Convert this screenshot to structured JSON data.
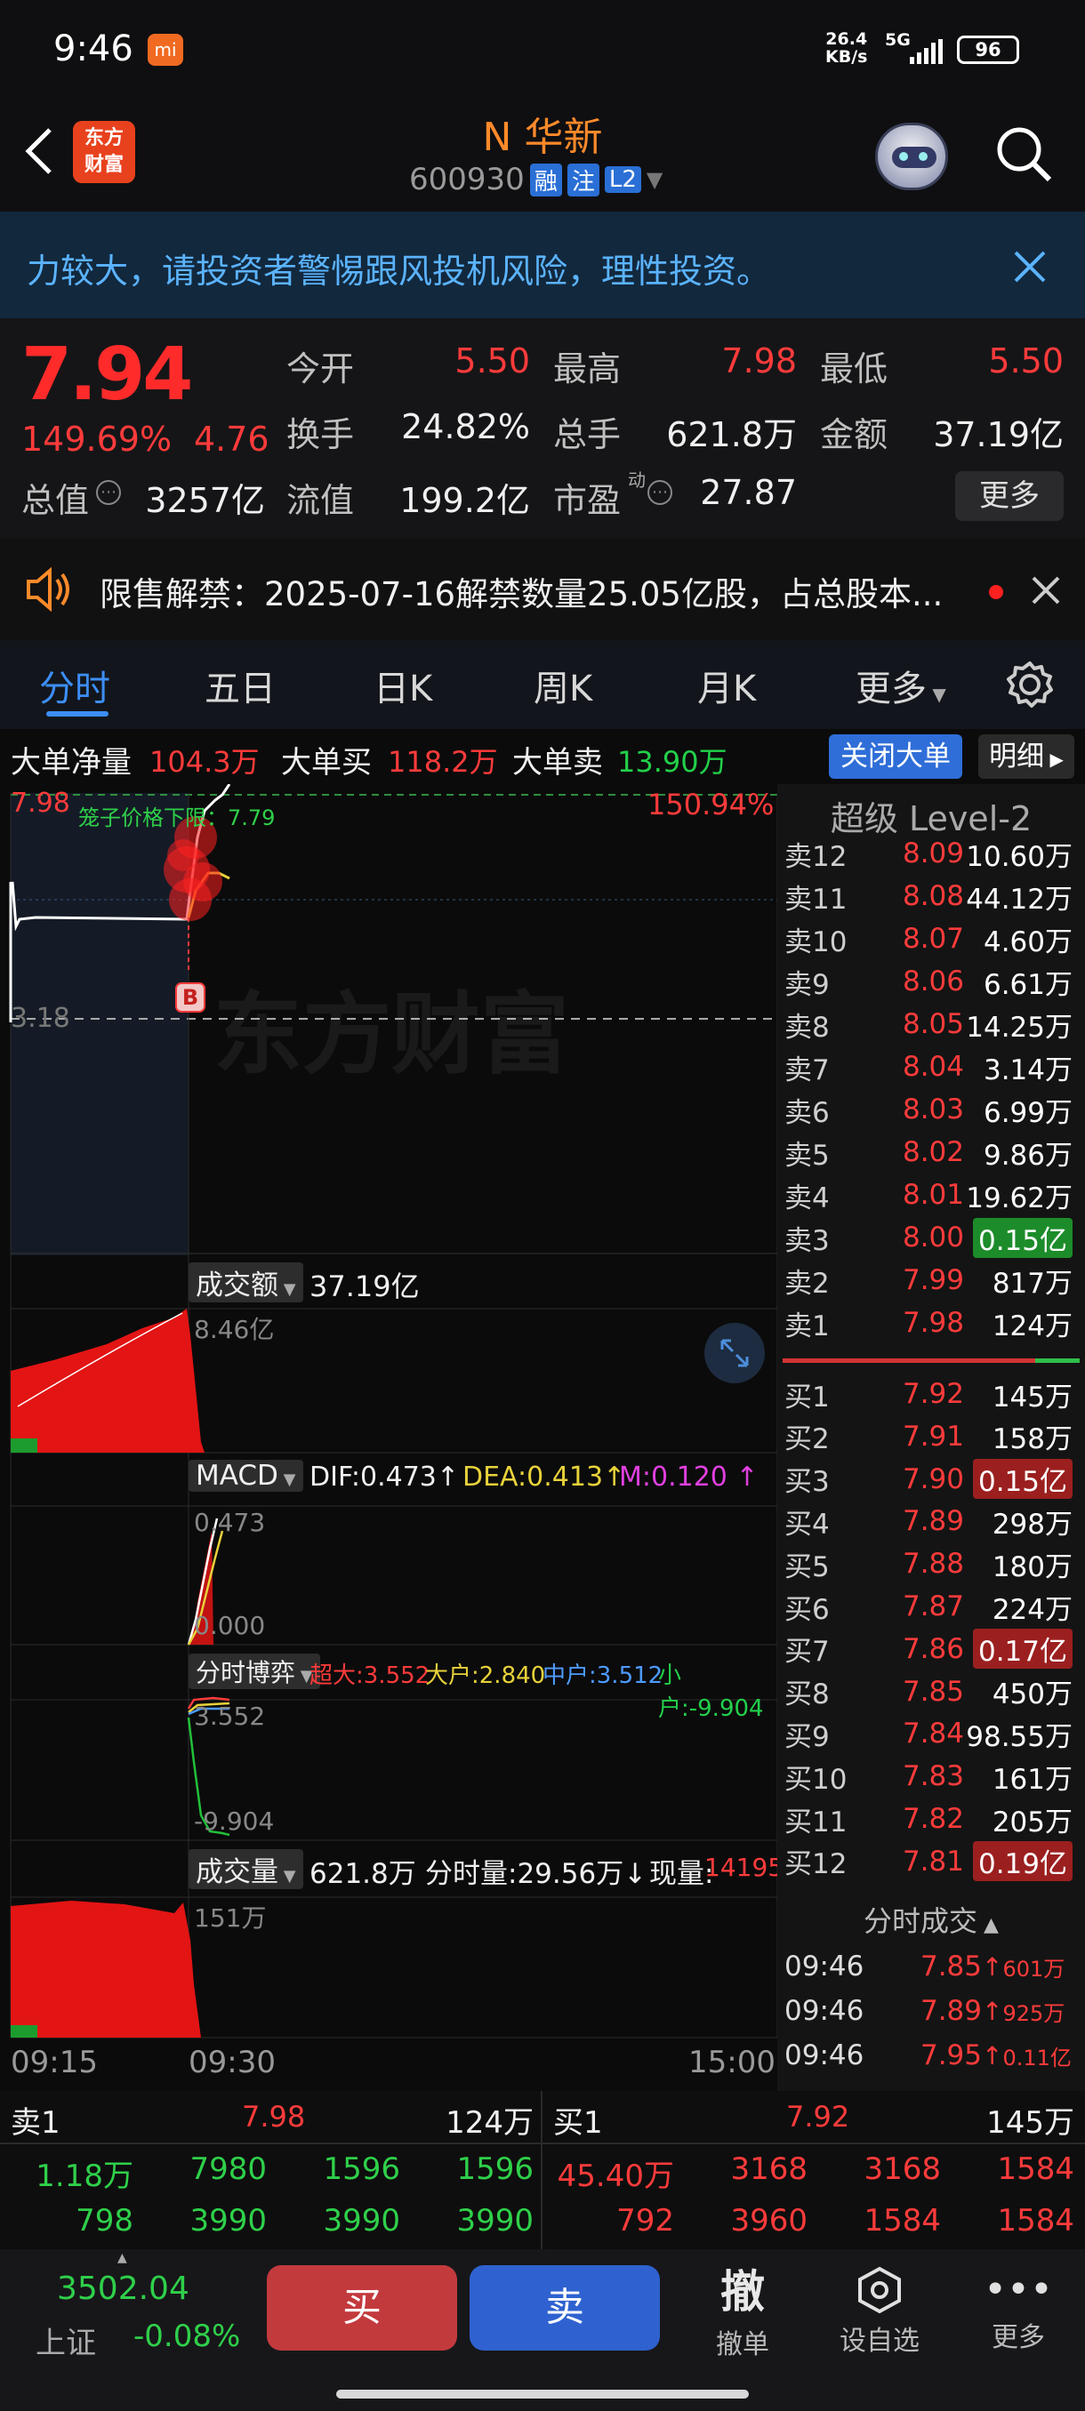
{
  "status": {
    "time": "9:46",
    "net_speed": "26.4\nKB/s",
    "net_speed_top": "26.4",
    "net_speed_bottom": "KB/s",
    "signal": "5G",
    "battery": "96"
  },
  "header": {
    "logo": "东方财富",
    "logo_top": "东方",
    "logo_bottom": "财富",
    "stock_name": "N 华新",
    "stock_code": "600930",
    "tags": [
      "融",
      "注",
      "L2"
    ]
  },
  "banner": {
    "text": "力较大，请投资者警惕跟风投机风险，理性投资。"
  },
  "quote": {
    "price": "7.94",
    "change_pct": "149.69%",
    "change": "4.76",
    "fields": [
      {
        "label": "今开",
        "value": "5.50"
      },
      {
        "label": "最高",
        "value": "7.98"
      },
      {
        "label": "最低",
        "value": "5.50"
      },
      {
        "label": "换手",
        "value": "24.82%"
      },
      {
        "label": "总手",
        "value": "621.8万"
      },
      {
        "label": "金额",
        "value": "37.19亿"
      },
      {
        "label": "总值",
        "value": "3257亿"
      },
      {
        "label": "流值",
        "value": "199.2亿"
      },
      {
        "label": "市盈",
        "value": "27.87"
      }
    ],
    "pe_superscript": "动",
    "more_label": "更多"
  },
  "notice": {
    "text": "限售解禁：2025-07-16解禁数量25.05亿股，占总股本..."
  },
  "tabs": {
    "items": [
      "分时",
      "五日",
      "日K",
      "周K",
      "月K",
      "更多"
    ],
    "active": 0
  },
  "bigorder": {
    "net_label": "大单净量",
    "net_value": "104.3万",
    "buy_label": "大单买",
    "buy_value": "118.2万",
    "sell_label": "大单卖",
    "sell_value": "13.90万",
    "close_btn": "关闭大单",
    "detail_btn": "明细"
  },
  "chart": {
    "price_top": "7.98",
    "pct_top": "150.94%",
    "cage_label": "笼子价格下限：7.79",
    "price_base": "3.18",
    "watermark": "东方财富",
    "trade_marker": "B",
    "amount_label": "成交额",
    "amount_value": "37.19亿",
    "amount_max": "8.46亿",
    "macd_label": "MACD",
    "dif": "DIF:0.473↑",
    "dea": "DEA:0.413↑",
    "m": "M:0.120 ↑",
    "macd_top": "0.473",
    "macd_bottom": "0.000",
    "game_label": "分时博弈",
    "super": "超大:3.552",
    "large": "大户:2.840",
    "mid": "中户:3.512",
    "small": "小户:-9.904",
    "game_top": "3.552",
    "game_bottom": "-9.904",
    "vol_label": "成交量",
    "vol_value": "621.8万",
    "vol_fen": "分时量:29.56万↓",
    "vol_now_label": "现量:",
    "vol_now": "14195",
    "vol_max": "151万",
    "time_start": "09:15",
    "time_mid": "09:30",
    "time_end": "15:00"
  },
  "level2": {
    "title": "超级 Level-2",
    "asks": [
      {
        "label": "卖12",
        "price": "8.09",
        "vol": "10.60万"
      },
      {
        "label": "卖11",
        "price": "8.08",
        "vol": "44.12万"
      },
      {
        "label": "卖10",
        "price": "8.07",
        "vol": "4.60万"
      },
      {
        "label": "卖9",
        "price": "8.06",
        "vol": "6.61万"
      },
      {
        "label": "卖8",
        "price": "8.05",
        "vol": "14.25万"
      },
      {
        "label": "卖7",
        "price": "8.04",
        "vol": "3.14万"
      },
      {
        "label": "卖6",
        "price": "8.03",
        "vol": "6.99万"
      },
      {
        "label": "卖5",
        "price": "8.02",
        "vol": "9.86万"
      },
      {
        "label": "卖4",
        "price": "8.01",
        "vol": "19.62万"
      },
      {
        "label": "卖3",
        "price": "8.00",
        "vol": "0.15亿"
      },
      {
        "label": "卖2",
        "price": "7.99",
        "vol": "817万"
      },
      {
        "label": "卖1",
        "price": "7.98",
        "vol": "124万"
      }
    ],
    "bids": [
      {
        "label": "买1",
        "price": "7.92",
        "vol": "145万"
      },
      {
        "label": "买2",
        "price": "7.91",
        "vol": "158万"
      },
      {
        "label": "买3",
        "price": "7.90",
        "vol": "0.15亿"
      },
      {
        "label": "买4",
        "price": "7.89",
        "vol": "298万"
      },
      {
        "label": "买5",
        "price": "7.88",
        "vol": "180万"
      },
      {
        "label": "买6",
        "price": "7.87",
        "vol": "224万"
      },
      {
        "label": "买7",
        "price": "7.86",
        "vol": "0.17亿"
      },
      {
        "label": "买8",
        "price": "7.85",
        "vol": "450万"
      },
      {
        "label": "买9",
        "price": "7.84",
        "vol": "98.55万"
      },
      {
        "label": "买10",
        "price": "7.83",
        "vol": "161万"
      },
      {
        "label": "买11",
        "price": "7.82",
        "vol": "205万"
      },
      {
        "label": "买12",
        "price": "7.81",
        "vol": "0.19亿"
      }
    ],
    "trades_title": "分时成交",
    "trades": [
      {
        "time": "09:46",
        "price": "7.85",
        "vol": "601万"
      },
      {
        "time": "09:46",
        "price": "7.89",
        "vol": "925万"
      },
      {
        "time": "09:46",
        "price": "7.95",
        "vol": "0.11亿"
      }
    ]
  },
  "bottomq": {
    "sell1_label": "卖1",
    "sell1_price": "7.98",
    "sell1_vol": "124万",
    "buy1_label": "买1",
    "buy1_price": "7.92",
    "buy1_vol": "145万",
    "sell_rows": [
      [
        "1.18万",
        "7980",
        "1596",
        "1596"
      ],
      [
        "798",
        "3990",
        "3990",
        "3990"
      ]
    ],
    "buy_rows": [
      [
        "45.40万",
        "3168",
        "3168",
        "1584"
      ],
      [
        "792",
        "3960",
        "1584",
        "1584"
      ]
    ]
  },
  "toolbar": {
    "index_value": "3502.04",
    "index_name": "上证",
    "index_change": "-0.08%",
    "buy": "买",
    "sell": "卖",
    "cancel_icon": "撤",
    "cancel": "撤单",
    "watch": "设自选",
    "more": "更多"
  }
}
